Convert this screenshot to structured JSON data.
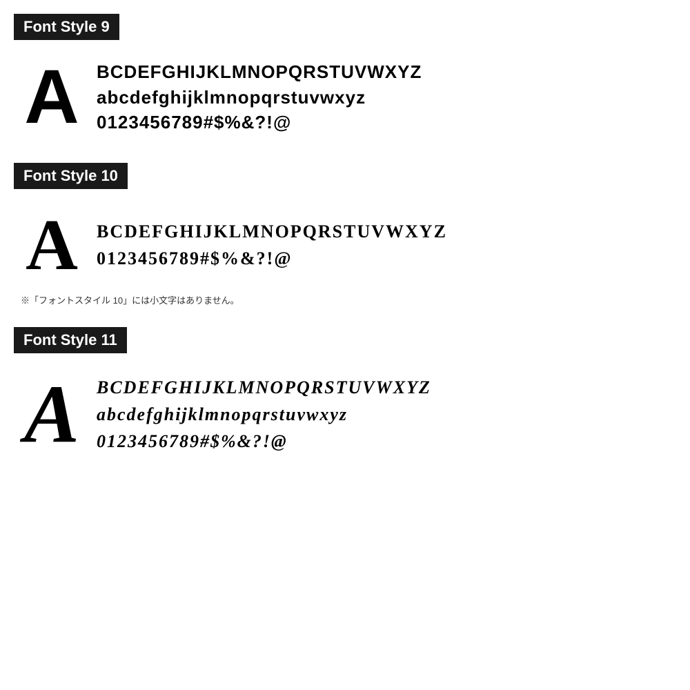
{
  "sections": [
    {
      "id": "font-style-9",
      "header_label": "Font Style 9",
      "big_letter": "A",
      "lines": [
        "BCDEFGHIJKLMNOPQRSTUVWXYZ",
        "abcdefghijklmnopqrstuvwxyz",
        "0123456789#$%&?!@"
      ],
      "note": null
    },
    {
      "id": "font-style-10",
      "header_label": "Font Style 10",
      "big_letter": "A",
      "lines": [
        "BCDEFGHIJKLMNOPQRSTUVWXYZ",
        "0123456789#$%&?!@"
      ],
      "note": "※「フォントスタイル 10」には小文字はありません。"
    },
    {
      "id": "font-style-11",
      "header_label": "Font Style 11",
      "big_letter": "A",
      "lines": [
        "BCDEFGHIJKLMNOPQRSTUVWXYZ",
        "abcdefghijklmnopqrstuvwxyz",
        "0123456789#$%&?!@"
      ],
      "note": null
    }
  ],
  "colors": {
    "header_bg": "#1a1a1a",
    "header_text": "#ffffff",
    "body_text": "#000000",
    "note_text": "#333333",
    "background": "#ffffff"
  }
}
